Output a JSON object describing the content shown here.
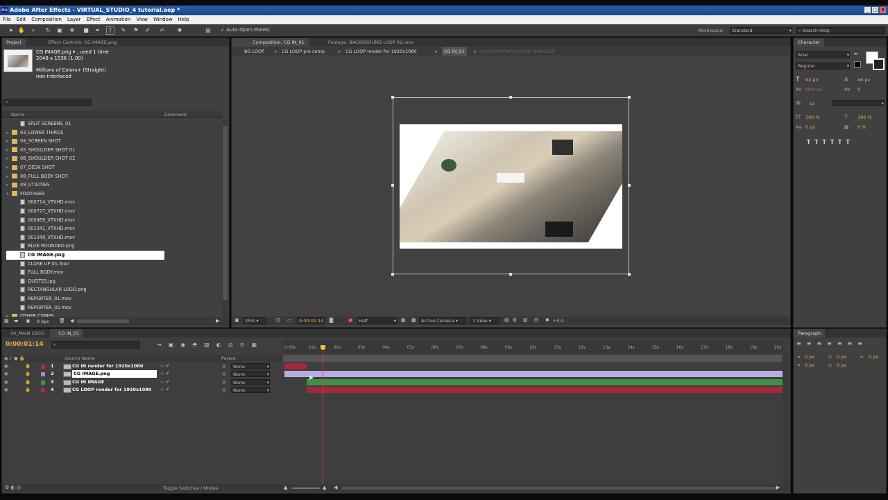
{
  "window": {
    "title": "Adobe After Effects - VIRTUAL_STUDIO_4 tutorial.aep *"
  },
  "menu": [
    "File",
    "Edit",
    "Composition",
    "Layer",
    "Effect",
    "Animation",
    "View",
    "Window",
    "Help"
  ],
  "toolbar": {
    "auto_open": "Auto-Open Panels",
    "workspace_label": "Workspace:",
    "workspace": "Standard",
    "search": "Search Help"
  },
  "project": {
    "tab": "Project",
    "effect_tab": "Effect Controls: CG IMAGE.png",
    "item_name": "CG IMAGE.png ▾ , used 1 time",
    "item_dims": "2048 x 1536 (1.00)",
    "item_colors": "Millions of Colors+ (Straight)",
    "item_interlace": "non-interlaced",
    "col_name": "Name",
    "col_comment": "Comment",
    "bpc": "8 bpc",
    "items": [
      {
        "label": "SPLIT SCREENS_01",
        "type": "footage-child"
      },
      {
        "label": "03_LOWER THIRDS",
        "type": "folder"
      },
      {
        "label": "04_SCREEN SHOT",
        "type": "folder"
      },
      {
        "label": "05_SHOULDER SHOT 01",
        "type": "folder"
      },
      {
        "label": "06_SHOULDER SHOT 02",
        "type": "folder"
      },
      {
        "label": "07_DESK SHOT",
        "type": "folder"
      },
      {
        "label": "08_FULL BODY SHOT",
        "type": "folder"
      },
      {
        "label": "09_UTILITIES",
        "type": "folder"
      },
      {
        "label": "FOOTAGES",
        "type": "folder-open"
      },
      {
        "label": "000714_VTXHD.mov",
        "type": "file"
      },
      {
        "label": "000727_VTXHD.mov",
        "type": "file"
      },
      {
        "label": "000869_VTXHD.mov",
        "type": "file"
      },
      {
        "label": "001041_VTXHD.mov",
        "type": "file"
      },
      {
        "label": "001049_VTXHD.mov",
        "type": "file"
      },
      {
        "label": "BLUE ROUNDED.png",
        "type": "file"
      },
      {
        "label": "CG IMAGE.png",
        "type": "file",
        "selected": true
      },
      {
        "label": "CLOSE UP 01.mov",
        "type": "file"
      },
      {
        "label": "FULL BODY.mov",
        "type": "file"
      },
      {
        "label": "QUOTES.jpg",
        "type": "file"
      },
      {
        "label": "RECTANGULAR LOGO.png",
        "type": "file"
      },
      {
        "label": "REPORTER_01.mov",
        "type": "file"
      },
      {
        "label": "REPORTER_02.mov",
        "type": "file"
      },
      {
        "label": "OTHER COMPS",
        "type": "folder"
      }
    ]
  },
  "comp": {
    "tab": "Composition: CG IN_01",
    "footage_tab": "Footage: BACKGROUND LOOP 02.mov",
    "breadcrumbs": [
      "BG LOOP",
      "CG LOOP pre comp",
      "CG LOOP render for 1920x1080",
      "CG IN_01",
      "LOGO/MOTION COLOR CHANGER"
    ],
    "zoom": "25%",
    "timecode": "0:00:01:14",
    "resolution": "Half",
    "camera": "Active Camera",
    "views": "1 View",
    "exposure": "+0.0"
  },
  "character": {
    "tab": "Character",
    "font": "Arial",
    "style": "Regular",
    "size": "92 px",
    "leading": "46 px",
    "kerning": "Metrics",
    "tracking": "0",
    "unit": "px",
    "vscale": "100 %",
    "hscale": "100 %",
    "baseline": "0 px",
    "tsume": "0 %"
  },
  "paragraph": {
    "tab": "Paragraph",
    "indent_left": "0 px",
    "indent_right": "0 px",
    "indent_first": "0 px",
    "space_before": "0 px",
    "space_after": "0 px"
  },
  "timeline": {
    "tabs": [
      "00_MAIN LOGO",
      "CG IN_01"
    ],
    "current_time": "0:00:01:14",
    "col_source": "Source Name",
    "col_parent": "Parent",
    "toggle": "Toggle Switches / Modes",
    "ticks": [
      "0:00s",
      "01s",
      "02s",
      "03s",
      "04s",
      "05s",
      "06s",
      "07s",
      "08s",
      "09s",
      "10s",
      "11s",
      "12s",
      "13s",
      "14s",
      "15s",
      "16s",
      "17s",
      "18s",
      "19s",
      "20s"
    ],
    "layers": [
      {
        "num": "1",
        "name": "CG IN render for 1920x1080",
        "parent": "None",
        "label_color": "#b8283c",
        "bar_color": "#a3283a",
        "start": 0,
        "end": 0.9
      },
      {
        "num": "2",
        "name": "CG IMAGE.png",
        "parent": "None",
        "label_color": "#9a8fd0",
        "bar_color": "#b6ade0",
        "start": 0,
        "end": 20.4,
        "selected": true
      },
      {
        "num": "3",
        "name": "CG IN IMAGE",
        "parent": "None",
        "label_color": "#3c9a4a",
        "bar_color": "#3f8f4a",
        "start": 0.9,
        "end": 20.4
      },
      {
        "num": "4",
        "name": "CG LOOP render for 1920x1080",
        "parent": "None",
        "label_color": "#b8283c",
        "bar_color": "#a3283a",
        "start": 0.9,
        "end": 20.4
      }
    ]
  }
}
